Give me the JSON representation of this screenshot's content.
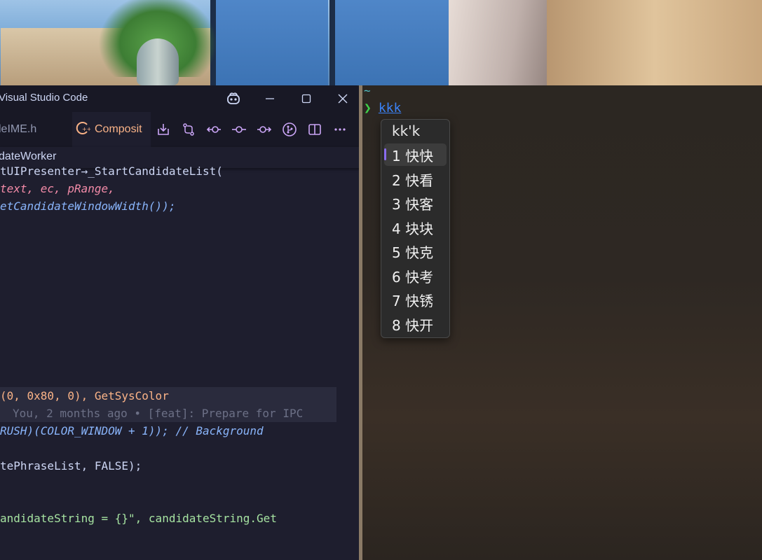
{
  "vscode": {
    "window_title": "Visual Studio Code",
    "tabs": [
      {
        "label": "leIME.h",
        "active": false
      },
      {
        "label": "Composit",
        "active": true
      }
    ],
    "breadcrumb": "dateWorker",
    "code_lines": [
      "tUIPresenter→_StartCandidateList(",
      "text, ec, pRange,",
      "etCandidateWindowWidth());",
      "(0, 0x80, 0), GetSysColor",
      "You, 2 months ago • [feat]: Prepare for IPC",
      "RUSH)(COLOR_WINDOW + 1)); // Background",
      "tePhraseList, FALSE);",
      "andidateString = {}\", candidateString.Get"
    ],
    "blame": "You, 2 months ago • [feat]: Prepare for IPC"
  },
  "terminal": {
    "cwd": "~",
    "prompt_symbol": "❯",
    "input": "kkk"
  },
  "ime": {
    "composition": "kk'k",
    "selected_index": 0,
    "candidates": [
      "1 快快",
      "2 快看",
      "3 快客",
      "4 块块",
      "5 快克",
      "6 快考",
      "7 快锈",
      "8 快开"
    ]
  },
  "colors": {
    "editor_bg": "#1e1e2e",
    "title_bg": "#181825",
    "active_tab_fg": "#fab387",
    "prompt_green": "#3fd14a",
    "command_blue": "#3b82f6",
    "selection_indicator": "#8a6cf0"
  }
}
